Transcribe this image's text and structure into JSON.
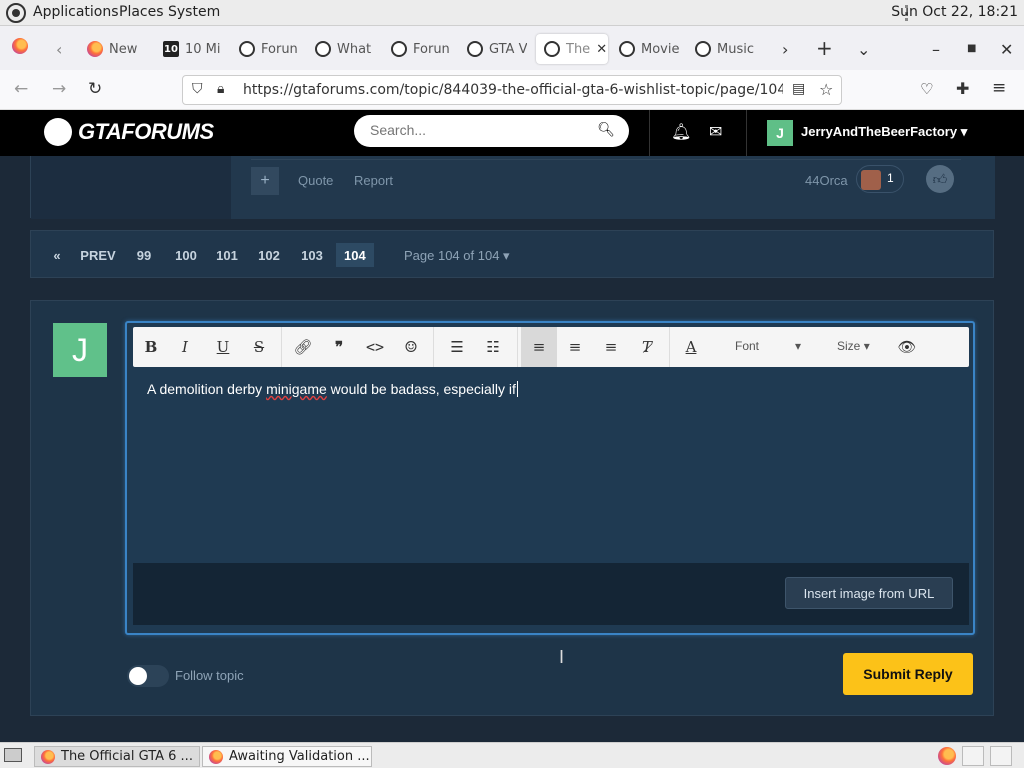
{
  "system": {
    "menus": [
      "Applications",
      "Places",
      "System"
    ],
    "clock": "Sun Oct 22, 18:21"
  },
  "browser": {
    "tabs": [
      {
        "label": "New",
        "icon": "firefox-icon"
      },
      {
        "label": "10 Mi",
        "icon": "ten-icon"
      },
      {
        "label": "Forun",
        "icon": "gta-icon"
      },
      {
        "label": "What",
        "icon": "gta-icon"
      },
      {
        "label": "Forun",
        "icon": "gta-icon"
      },
      {
        "label": "GTA V",
        "icon": "gta-icon"
      },
      {
        "label": "The",
        "icon": "gta-icon"
      },
      {
        "label": "Movie",
        "icon": "gta-icon"
      },
      {
        "label": "Music",
        "icon": "gta-icon"
      }
    ],
    "url": "https://gtaforums.com/topic/844039-the-official-gta-6-wishlist-topic/page/104/#comment"
  },
  "site": {
    "brand": "GTAFORUMS",
    "search_placeholder": "Search...",
    "username": "JerryAndTheBeerFactory",
    "avatar_letter": "J"
  },
  "post": {
    "actions": [
      "Quote",
      "Report"
    ],
    "reaction_user": "44Orca",
    "reaction_count": "1"
  },
  "pagination": {
    "first": "«",
    "prev": "PREV",
    "pages": [
      "99",
      "100",
      "101",
      "102",
      "103",
      "104"
    ],
    "current": "104",
    "info": "Page 104 of 104"
  },
  "reply": {
    "avatar_letter": "J",
    "toolbar": {
      "font_label": "Font",
      "size_label": "Size"
    },
    "text_before": "A demolition derby ",
    "text_misspelled": "minigame",
    "text_after": " would be badass, especially if",
    "insert_image_label": "Insert image from URL",
    "follow_label": "Follow topic",
    "submit_label": "Submit Reply"
  },
  "taskbar": {
    "items": [
      "The Official GTA 6 ...",
      "Awaiting Validation ..."
    ]
  }
}
